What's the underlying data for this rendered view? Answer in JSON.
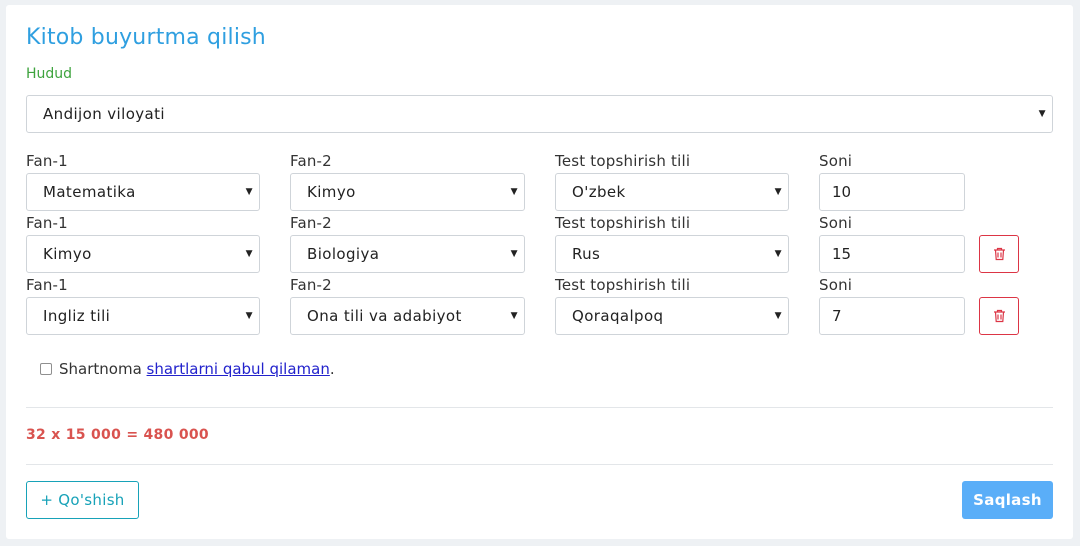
{
  "page": {
    "title": "Kitob buyurtma qilish",
    "region_label": "Hudud",
    "region_value": "Andijon viloyati"
  },
  "labels": {
    "subject1": "Fan-1",
    "subject2": "Fan-2",
    "language": "Test topshirish tili",
    "quantity": "Soni"
  },
  "rows": [
    {
      "subject1": "Matematika",
      "subject2": "Kimyo",
      "language": "O'zbek",
      "quantity": "10",
      "deletable": false
    },
    {
      "subject1": "Kimyo",
      "subject2": "Biologiya",
      "language": "Rus",
      "quantity": "15",
      "deletable": true
    },
    {
      "subject1": "Ingliz tili",
      "subject2": "Ona tili va adabiyot",
      "language": "Qoraqalpoq",
      "quantity": "7",
      "deletable": true
    }
  ],
  "agreement": {
    "prefix": "Shartnoma",
    "link": "shartlarni qabul qilaman",
    "suffix": ".",
    "checked": false
  },
  "total": "32 x 15 000 = 480 000",
  "buttons": {
    "add": "+ Qo'shish",
    "save": "Saqlash"
  },
  "icons": {
    "caret": "caret-down-icon",
    "delete": "trash-icon"
  },
  "colors": {
    "title": "#2f9fe0",
    "region_label": "#3ea33e",
    "total": "#d9534f",
    "add_button": "#17a2b8",
    "save_button": "#5aaef8",
    "delete_button": "#dc3545"
  }
}
